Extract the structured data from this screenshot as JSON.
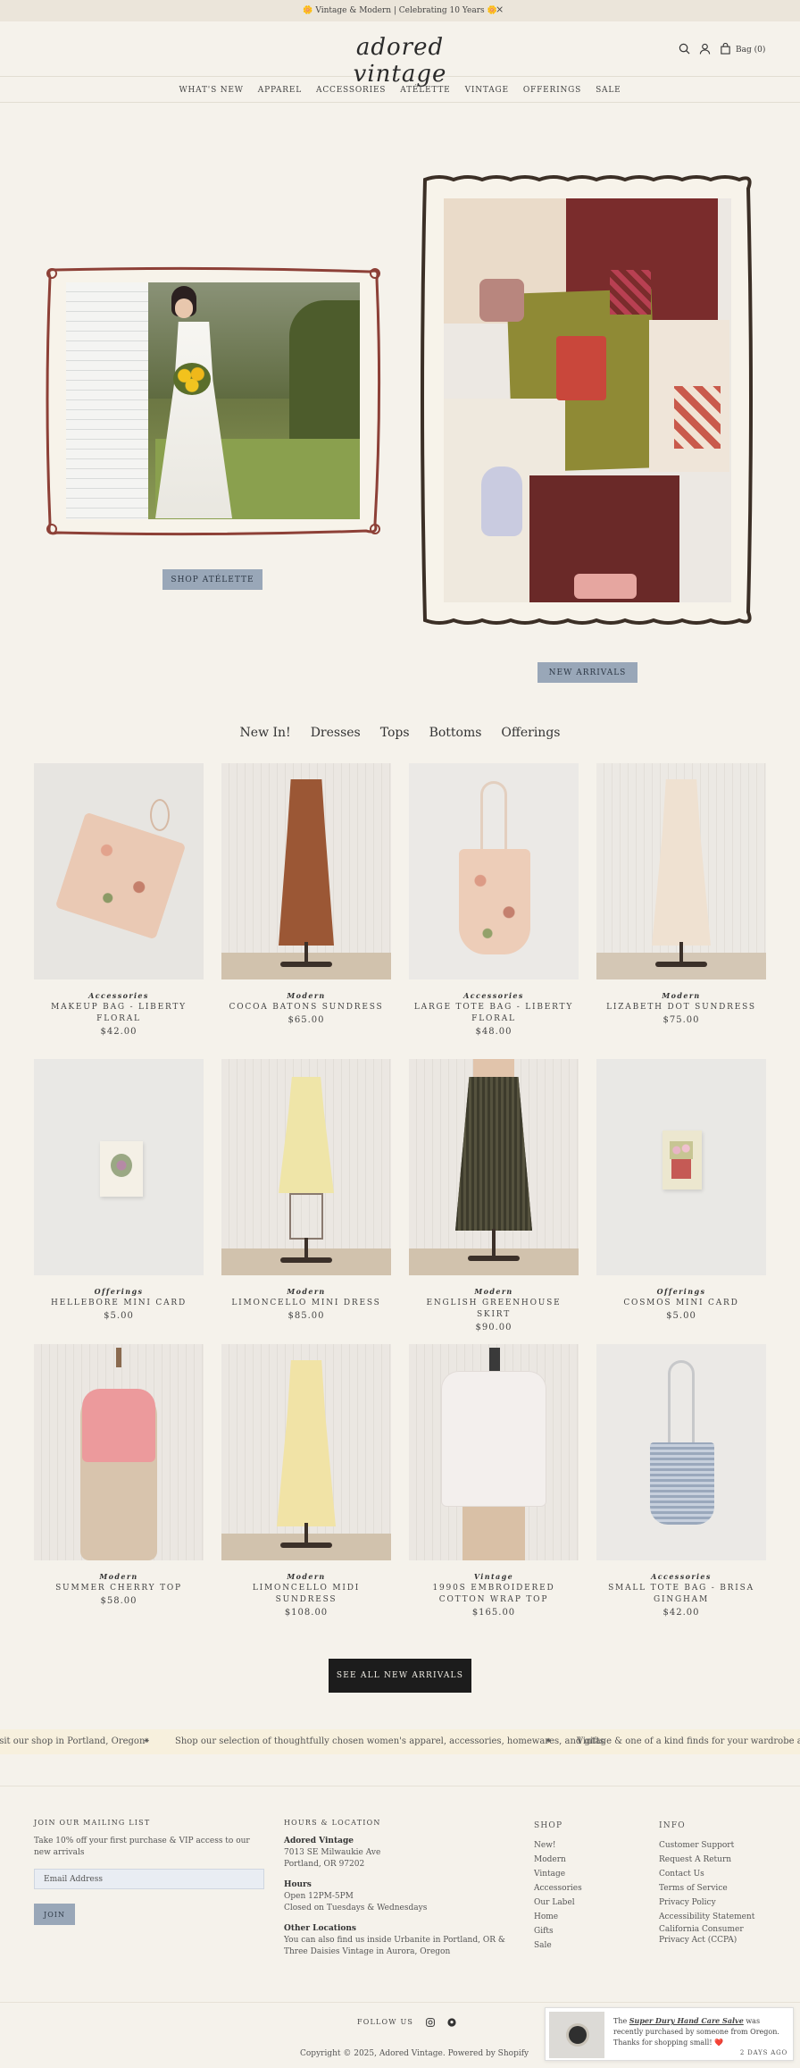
{
  "announcement": {
    "text": "🌼 Vintage & Modern | Celebrating 10 Years 🌼",
    "close": "×"
  },
  "header": {
    "logo": "adored vintage",
    "bag_label": "Bag (0)"
  },
  "nav": {
    "items": [
      "WHAT'S NEW",
      "APPAREL",
      "ACCESSORIES",
      "ATÉLETTE",
      "VINTAGE",
      "OFFERINGS",
      "SALE"
    ]
  },
  "hero": {
    "left_button": "SHOP ATÉLETTE",
    "right_button": "NEW ARRIVALS"
  },
  "tabs": [
    "New In!",
    "Dresses",
    "Tops",
    "Bottoms",
    "Offerings"
  ],
  "products": [
    {
      "category": "Accessories",
      "name": "MAKEUP BAG - LIBERTY FLORAL",
      "price": "$42.00"
    },
    {
      "category": "Modern",
      "name": "COCOA BATONS SUNDRESS",
      "price": "$65.00"
    },
    {
      "category": "Accessories",
      "name": "LARGE TOTE BAG - LIBERTY FLORAL",
      "price": "$48.00"
    },
    {
      "category": "Modern",
      "name": "LIZABETH DOT SUNDRESS",
      "price": "$75.00"
    },
    {
      "category": "Offerings",
      "name": "HELLEBORE MINI CARD",
      "price": "$5.00"
    },
    {
      "category": "Modern",
      "name": "LIMONCELLO MINI DRESS",
      "price": "$85.00"
    },
    {
      "category": "Modern",
      "name": "ENGLISH GREENHOUSE SKIRT",
      "price": "$90.00"
    },
    {
      "category": "Offerings",
      "name": "COSMOS MINI CARD",
      "price": "$5.00"
    },
    {
      "category": "Modern",
      "name": "SUMMER CHERRY TOP",
      "price": "$58.00"
    },
    {
      "category": "Modern",
      "name": "LIMONCELLO MIDI SUNDRESS",
      "price": "$108.00"
    },
    {
      "category": "Vintage",
      "name": "1990S EMBROIDERED COTTON WRAP TOP",
      "price": "$165.00"
    },
    {
      "category": "Accessories",
      "name": "SMALL TOTE BAG - BRISA GINGHAM",
      "price": "$42.00"
    }
  ],
  "see_all": "SEE ALL NEW ARRIVALS",
  "marquee": {
    "items": [
      "isit our shop in Portland, Oregon",
      "Shop our selection of thoughtfully chosen women's apparel, accessories, homewares, and gifts",
      "Vintage & one of a kind finds for your wardrobe and home"
    ],
    "separator": "⁕"
  },
  "footer": {
    "mailing": {
      "heading": "JOIN OUR MAILING LIST",
      "text": "Take 10% off your first purchase & VIP access to our new arrivals",
      "placeholder": "Email Address",
      "button": "JOIN"
    },
    "hours": {
      "heading": "HOURS & LOCATION",
      "store_name": "Adored Vintage",
      "address1": "7013 SE Milwaukie Ave",
      "address2": "Portland, OR 97202",
      "hours_label": "Hours",
      "hours1": "Open 12PM-5PM",
      "hours2": "Closed on Tuesdays & Wednesdays",
      "other_label": "Other Locations",
      "other_text": "You can also find us inside Urbanite in Portland, OR & Three Daisies Vintage in Aurora, Oregon"
    },
    "shop": {
      "heading": "SHOP",
      "items": [
        "New!",
        "Modern",
        "Vintage",
        "Accessories",
        "Our Label",
        "Home",
        "Gifts",
        "Sale"
      ]
    },
    "info": {
      "heading": "INFO",
      "items": [
        "Customer Support",
        "Request A Return",
        "Contact Us",
        "Terms of Service",
        "Privacy Policy",
        "Accessibility Statement",
        "California Consumer Privacy Act (CCPA)"
      ]
    },
    "follow": "FOLLOW US",
    "copyright": "Copyright © 2025, Adored Vintage. Powered by Shopify"
  },
  "toast": {
    "prefix": "The",
    "product": "Super Dury Hand Care Salve",
    "suffix": "was recently purchased by someone from Oregon. Thanks for shopping small! ❤️",
    "time": "2 DAYS AGO"
  }
}
